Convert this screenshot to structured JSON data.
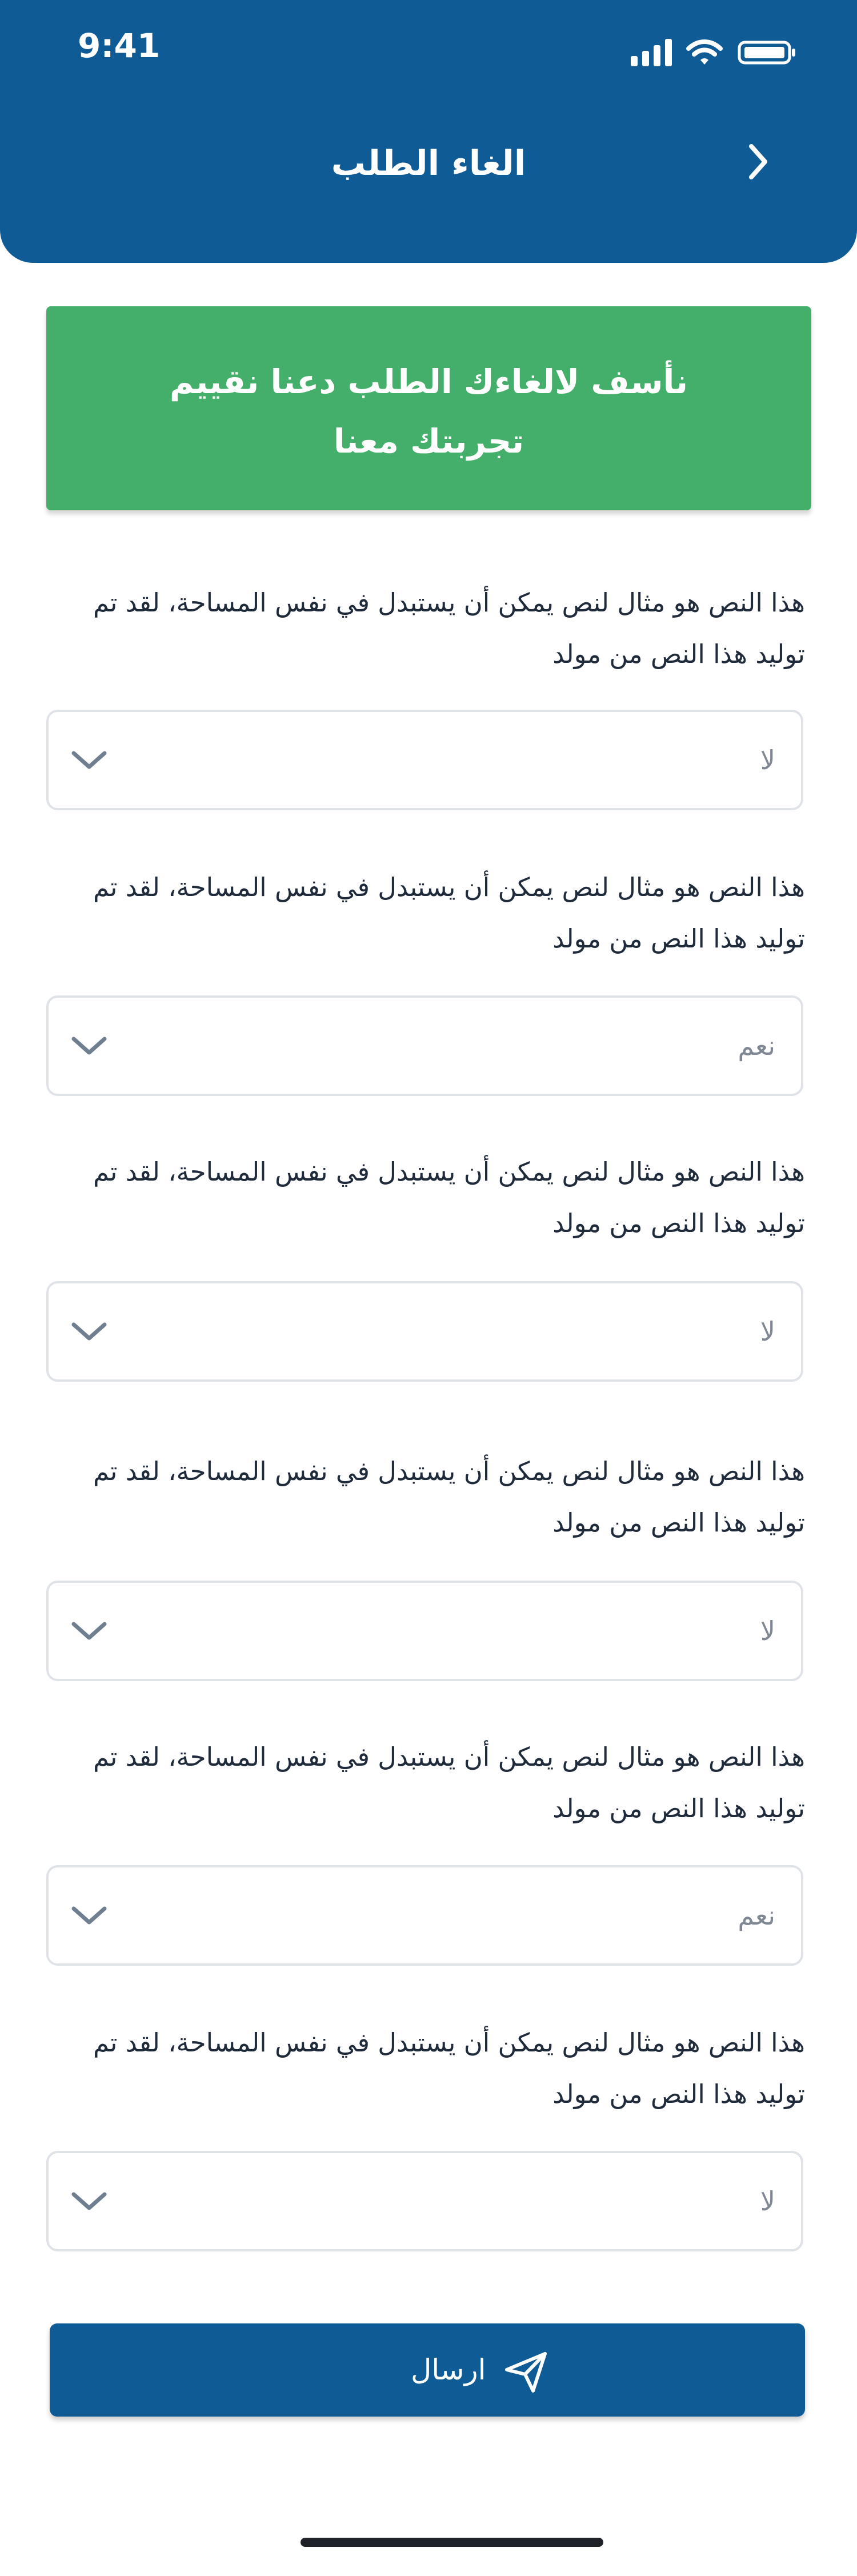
{
  "status_bar": {
    "time": "9:41"
  },
  "header": {
    "title": "الغاء الطلب"
  },
  "banner": {
    "text": "نأسف لالغاءك الطلب دعنا نقييم تجربتك معنا"
  },
  "questions": [
    {
      "text": "هذا النص هو مثال لنص يمكن أن يستبدل في نفس المساحة، لقد تم توليد هذا النص من مولد",
      "answer": "لا"
    },
    {
      "text": "هذا النص هو مثال لنص يمكن أن يستبدل في نفس المساحة، لقد تم توليد هذا النص من مولد",
      "answer": "نعم"
    },
    {
      "text": "هذا النص هو مثال لنص يمكن أن يستبدل في نفس المساحة، لقد تم توليد هذا النص من مولد",
      "answer": "لا"
    },
    {
      "text": "هذا النص هو مثال لنص يمكن أن يستبدل في نفس المساحة، لقد تم توليد هذا النص من مولد",
      "answer": "لا"
    },
    {
      "text": "هذا النص هو مثال لنص يمكن أن يستبدل في نفس المساحة، لقد تم توليد هذا النص من مولد",
      "answer": "نعم"
    },
    {
      "text": "هذا النص هو مثال لنص يمكن أن يستبدل في نفس المساحة، لقد تم توليد هذا النص من مولد",
      "answer": "لا"
    }
  ],
  "submit": {
    "label": "ارسال"
  },
  "icons": {
    "signal": "cellular-signal-icon",
    "wifi": "wifi-icon",
    "battery": "battery-icon",
    "back": "chevron-right-icon",
    "dropdown": "chevron-down-icon",
    "send": "paper-plane-icon"
  },
  "colors": {
    "primary": "#0F5B96",
    "success": "#44AF6A",
    "border": "#DFE3E8",
    "muted_text": "#7F8793",
    "text": "#1F2A3A"
  }
}
